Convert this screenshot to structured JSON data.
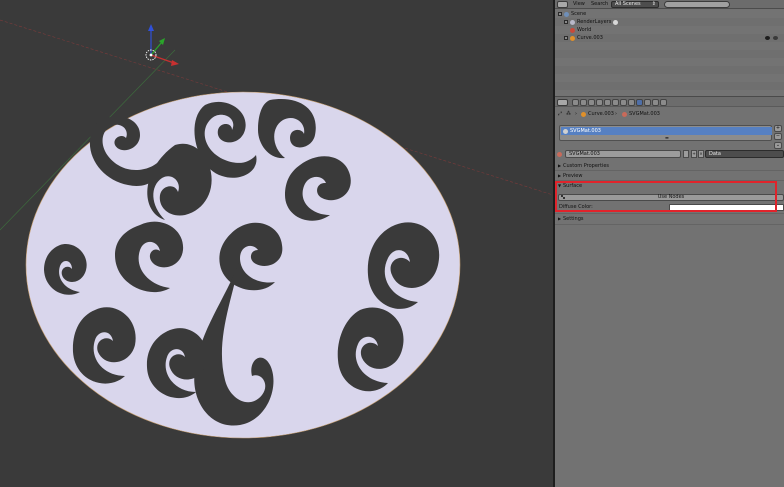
{
  "outliner": {
    "header": {
      "view_label": "View",
      "search_label": "Search",
      "scenes_select": "All Scenes"
    },
    "items": [
      {
        "label": "Scene",
        "icon": "scene-icon"
      },
      {
        "label": "RenderLayers",
        "icon": "renderlayers-icon"
      },
      {
        "label": "World",
        "icon": "world-icon"
      },
      {
        "label": "Curve.003",
        "icon": "curve-object-icon"
      }
    ]
  },
  "properties": {
    "breadcrumb": {
      "object": "Curve.003",
      "material": "SVGMat.003"
    },
    "material_slot": "SVGMat.003",
    "material_name": "SVGMat.003",
    "link_select": "Data",
    "panels": {
      "custom_properties": "Custom Properties",
      "preview": "Preview",
      "surface": "Surface",
      "settings": "Settings"
    },
    "surface": {
      "use_nodes_label": "Use Nodes",
      "diffuse_color_label": "Diffuse Color:",
      "diffuse_color_value": "#ffffff"
    },
    "slot_side_buttons": [
      "+",
      "−",
      "⌄"
    ]
  },
  "colors": {
    "viewport_bg": "#3a3a3a",
    "shape_fill": "#d9d6ec",
    "highlight": "#e0232b",
    "selected_slot": "#5680c2"
  }
}
